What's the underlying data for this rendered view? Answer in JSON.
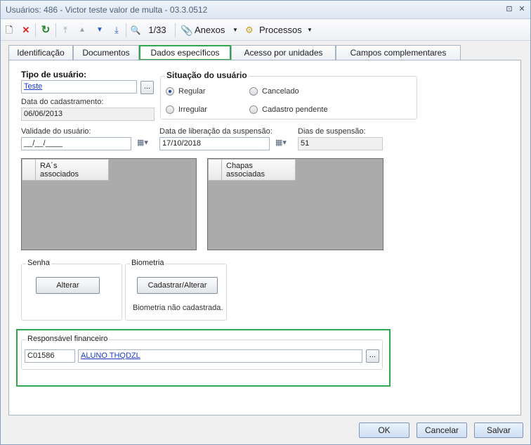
{
  "window": {
    "title": "Usuários: 486 - Victor teste valor de multa - 03.3.0512",
    "pin_icon": "⊡",
    "close_icon": "✕"
  },
  "toolbar": {
    "new_icon": "🗋",
    "delete_icon": "✕",
    "refresh_icon": "↻",
    "first_icon": "⤒",
    "prev_icon": "▲",
    "next_icon": "▼",
    "last_icon": "⤓",
    "search_icon": "🔍",
    "record_counter": "1/33",
    "attachments_label": "Anexos",
    "processes_label": "Processos",
    "dropdown_arrow": "▼"
  },
  "tabs": [
    {
      "label": "Identificação"
    },
    {
      "label": "Documentos"
    },
    {
      "label": "Dados específicos"
    },
    {
      "label": "Acesso por unidades"
    },
    {
      "label": "Campos complementares"
    }
  ],
  "form": {
    "user_type_label": "Tipo de usuário:",
    "user_type_value": "Teste",
    "ellipsis": "...",
    "registration_date_label": "Data do cadastramento:",
    "registration_date_value": "06/06/2013",
    "user_status": {
      "title": "Situação do usuário",
      "options": [
        {
          "label": "Regular",
          "selected": true
        },
        {
          "label": "Cancelado",
          "selected": false
        },
        {
          "label": "Irregular",
          "selected": false
        },
        {
          "label": "Cadastro pendente",
          "selected": false
        }
      ]
    },
    "validity_label": "Validade do usuário:",
    "validity_value": "__/__/____",
    "suspension_release_label": "Data de liberação da suspensão:",
    "suspension_release_value": "17/10/2018",
    "suspension_days_label": "Dias de suspensão:",
    "suspension_days_value": "51",
    "calendar_icon": "▦▾",
    "ra_grid_header_line1": "RA´s",
    "ra_grid_header_line2": "associados",
    "plates_grid_header_line1": "Chapas",
    "plates_grid_header_line2": "associadas"
  },
  "password": {
    "title": "Senha",
    "change_button": "Alterar"
  },
  "biometrics": {
    "title": "Biometria",
    "register_button": "Cadastrar/Alterar",
    "status": "Biometria não cadastrada."
  },
  "financial": {
    "title": "Responsável financeiro",
    "code": "C01586",
    "name": "ALUNO THQDZL",
    "ellipsis": "..."
  },
  "footer": {
    "ok_label": "OK",
    "cancel_label": "Cancelar",
    "save_label": "Salvar"
  },
  "colors": {
    "highlight": "#2fa84f",
    "link": "#1a3cc8",
    "grid_bg": "#ababab"
  }
}
